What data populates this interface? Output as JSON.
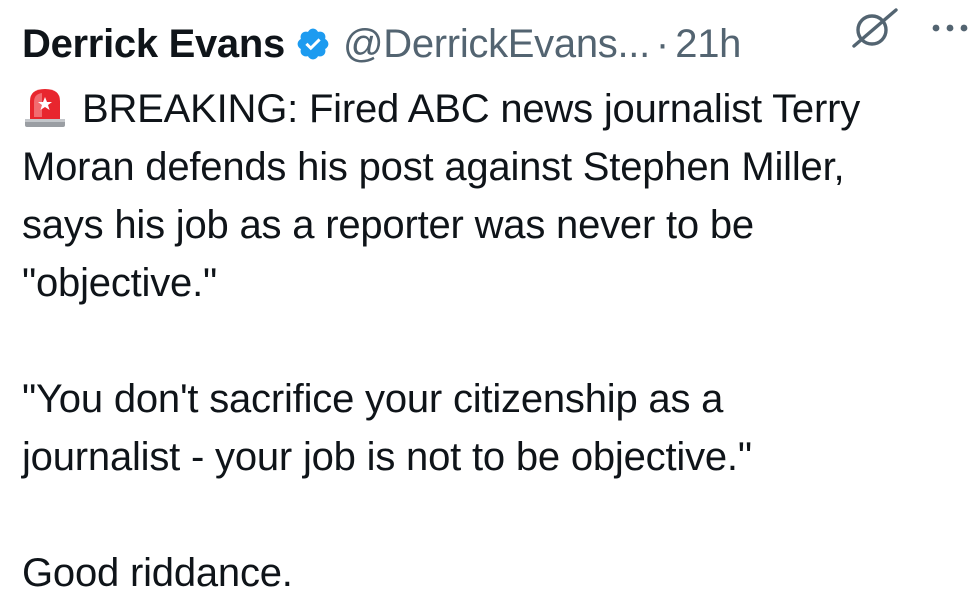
{
  "tweet": {
    "display_name": "Derrick Evans",
    "handle": "@DerrickEvans...",
    "separator": "·",
    "timestamp": "21h",
    "verified_color": "#1d9bf0",
    "body_lines": [
      "BREAKING: Fired ABC news journalist Terry",
      "Moran defends his post against Stephen Miller,",
      "says his job as a reporter was never to be",
      "\"objective.\"",
      "",
      "\"You don't sacrifice your citizenship as a",
      "journalist - your job is not to be objective.\"",
      "",
      "Good riddance."
    ],
    "icons": {
      "verified": "verified-badge-icon",
      "siren": "police-siren-emoji",
      "grok": "grok-icon",
      "more": "more-options-icon"
    }
  }
}
